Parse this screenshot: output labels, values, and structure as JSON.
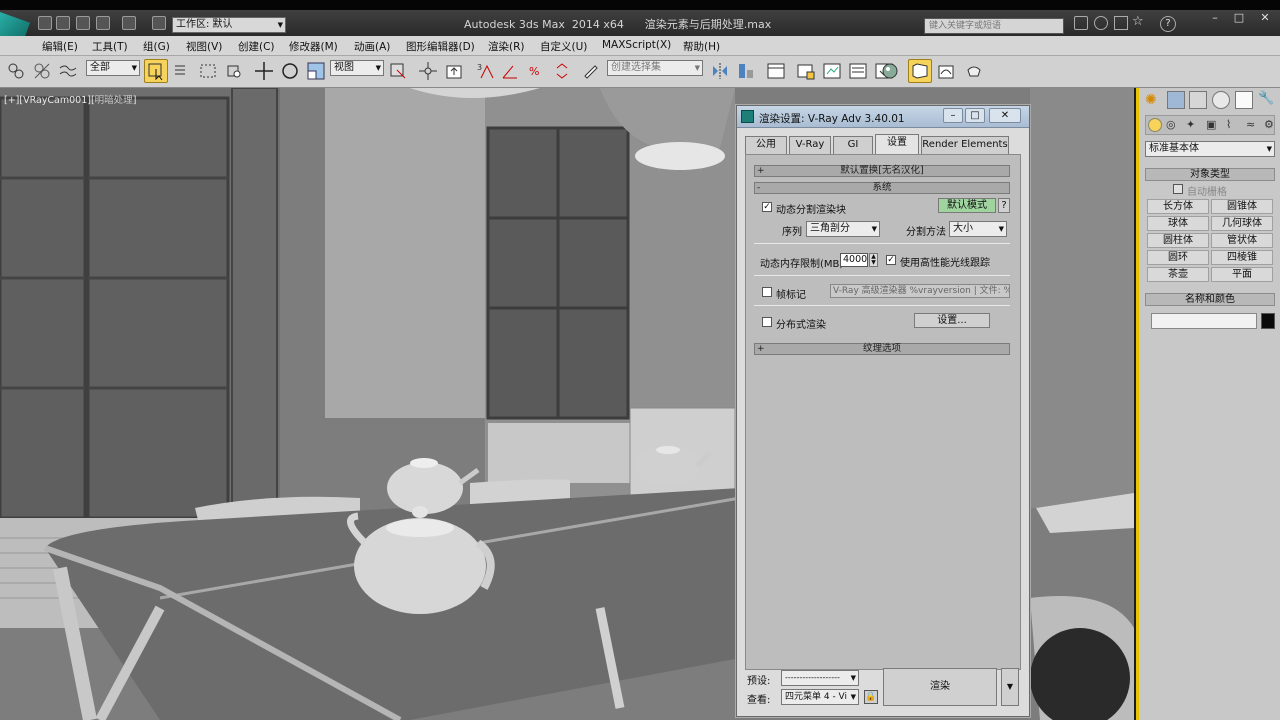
{
  "app": {
    "window_title": "Autodesk 3ds Max  2014 x64      渲染元素与后期处理.max",
    "workspace": "工作区: 默认",
    "search_placeholder": "键入关键字或短语"
  },
  "menu": [
    "编辑(E)",
    "工具(T)",
    "组(G)",
    "视图(V)",
    "创建(C)",
    "修改器(M)",
    "动画(A)",
    "图形编辑器(D)",
    "渲染(R)",
    "自定义(U)",
    "MAXScript(X)",
    "帮助(H)"
  ],
  "toolbar": {
    "selection_filter": "全部",
    "reference_coord": "视图",
    "named_selection": "创建选择集"
  },
  "viewport": {
    "label": "[+][VRayCam001][",
    "label_mode": "明暗处理",
    "label_end": "]"
  },
  "render_dialog": {
    "title": "渲染设置: V-Ray Adv 3.40.01",
    "tabs": [
      "公用",
      "V-Ray",
      "GI",
      "设置",
      "Render Elements"
    ],
    "active_tab": "设置",
    "rollout_default_displacement": "默认置换[无名汉化]",
    "rollout_system": "系统",
    "dynamic_split": "动态分割渲染块",
    "default_mode_button": "默认模式",
    "help_button": "?",
    "sequence_label": "序列",
    "sequence_value": "三角剖分",
    "split_method_label": "分割方法",
    "split_method_value": "大小",
    "dyn_mem_label": "动态内存限制(MB)",
    "dyn_mem_value": "4000",
    "high_perf_raytrace": "使用高性能光线跟踪",
    "frame_stamp": "帧标记",
    "frame_stamp_text": "V-Ray 高级渲染器 %vrayversion | 文件: %",
    "distributed_render": "分布式渲染",
    "settings_button": "设置...",
    "rollout_texture": "纹理选项",
    "preset_label": "预设:",
    "preset_value": "-------------------",
    "view_label": "查看:",
    "view_value": "四元菜单 4 - Vi",
    "render_button": "渲染"
  },
  "command_panel": {
    "category": "标准基本体",
    "object_type_header": "对象类型",
    "autogrid": "自动栅格",
    "objects": [
      "长方体",
      "圆锥体",
      "球体",
      "几何球体",
      "圆柱体",
      "管状体",
      "圆环",
      "四棱锥",
      "茶壶",
      "平面"
    ],
    "name_color_header": "名称和颜色"
  }
}
